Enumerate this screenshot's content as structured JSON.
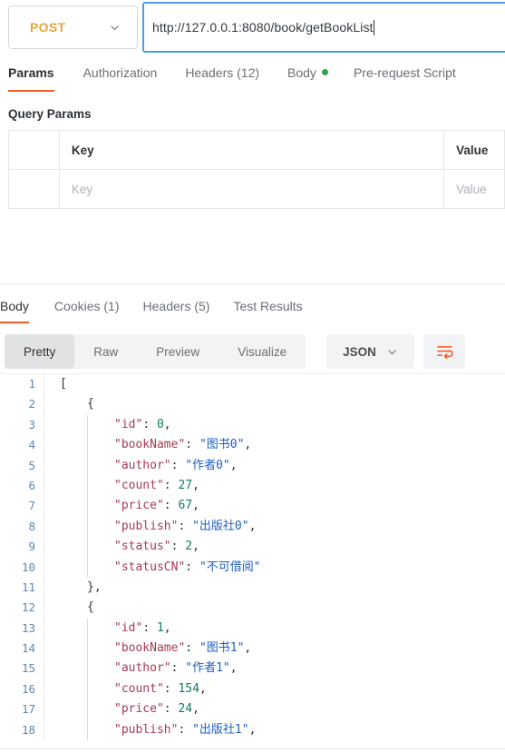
{
  "request": {
    "method": "POST",
    "method_caret_icon": "chevron-down-icon",
    "url": "http://127.0.0.1:8080/book/getBookList",
    "tabs": [
      {
        "label": "Params",
        "active": true
      },
      {
        "label": "Authorization",
        "active": false
      },
      {
        "label": "Headers (12)",
        "active": false
      },
      {
        "label": "Body",
        "active": false,
        "dot": true
      },
      {
        "label": "Pre-request Script",
        "active": false
      }
    ],
    "query_params": {
      "title": "Query Params",
      "columns": [
        "Key",
        "Value"
      ],
      "rows": [
        {
          "key_placeholder": "Key",
          "value_placeholder": "Value"
        }
      ]
    }
  },
  "response": {
    "tabs": [
      {
        "label": "Body",
        "active": true
      },
      {
        "label": "Cookies (1)",
        "active": false
      },
      {
        "label": "Headers (5)",
        "active": false
      },
      {
        "label": "Test Results",
        "active": false
      }
    ],
    "view_modes": [
      {
        "label": "Pretty",
        "active": true
      },
      {
        "label": "Raw",
        "active": false
      },
      {
        "label": "Preview",
        "active": false
      },
      {
        "label": "Visualize",
        "active": false
      }
    ],
    "format": {
      "label": "JSON",
      "caret_icon": "chevron-down-icon"
    },
    "wrap_icon": "wrap-lines-icon",
    "body_lines": [
      {
        "n": 1,
        "indent": 0,
        "tokens": [
          {
            "t": "p",
            "v": "["
          }
        ]
      },
      {
        "n": 2,
        "indent": 1,
        "tokens": [
          {
            "t": "p",
            "v": "{"
          }
        ]
      },
      {
        "n": 3,
        "indent": 2,
        "tokens": [
          {
            "t": "k",
            "v": "\"id\""
          },
          {
            "t": "p",
            "v": ": "
          },
          {
            "t": "n",
            "v": "0"
          },
          {
            "t": "p",
            "v": ","
          }
        ]
      },
      {
        "n": 4,
        "indent": 2,
        "tokens": [
          {
            "t": "k",
            "v": "\"bookName\""
          },
          {
            "t": "p",
            "v": ": "
          },
          {
            "t": "s",
            "v": "\"图书0\""
          },
          {
            "t": "p",
            "v": ","
          }
        ]
      },
      {
        "n": 5,
        "indent": 2,
        "tokens": [
          {
            "t": "k",
            "v": "\"author\""
          },
          {
            "t": "p",
            "v": ": "
          },
          {
            "t": "s",
            "v": "\"作者0\""
          },
          {
            "t": "p",
            "v": ","
          }
        ]
      },
      {
        "n": 6,
        "indent": 2,
        "tokens": [
          {
            "t": "k",
            "v": "\"count\""
          },
          {
            "t": "p",
            "v": ": "
          },
          {
            "t": "n",
            "v": "27"
          },
          {
            "t": "p",
            "v": ","
          }
        ]
      },
      {
        "n": 7,
        "indent": 2,
        "tokens": [
          {
            "t": "k",
            "v": "\"price\""
          },
          {
            "t": "p",
            "v": ": "
          },
          {
            "t": "n",
            "v": "67"
          },
          {
            "t": "p",
            "v": ","
          }
        ]
      },
      {
        "n": 8,
        "indent": 2,
        "tokens": [
          {
            "t": "k",
            "v": "\"publish\""
          },
          {
            "t": "p",
            "v": ": "
          },
          {
            "t": "s",
            "v": "\"出版社0\""
          },
          {
            "t": "p",
            "v": ","
          }
        ]
      },
      {
        "n": 9,
        "indent": 2,
        "tokens": [
          {
            "t": "k",
            "v": "\"status\""
          },
          {
            "t": "p",
            "v": ": "
          },
          {
            "t": "n",
            "v": "2"
          },
          {
            "t": "p",
            "v": ","
          }
        ]
      },
      {
        "n": 10,
        "indent": 2,
        "tokens": [
          {
            "t": "k",
            "v": "\"statusCN\""
          },
          {
            "t": "p",
            "v": ": "
          },
          {
            "t": "s",
            "v": "\"不可借阅\""
          }
        ]
      },
      {
        "n": 11,
        "indent": 1,
        "tokens": [
          {
            "t": "p",
            "v": "},"
          }
        ]
      },
      {
        "n": 12,
        "indent": 1,
        "tokens": [
          {
            "t": "p",
            "v": "{"
          }
        ]
      },
      {
        "n": 13,
        "indent": 2,
        "tokens": [
          {
            "t": "k",
            "v": "\"id\""
          },
          {
            "t": "p",
            "v": ": "
          },
          {
            "t": "n",
            "v": "1"
          },
          {
            "t": "p",
            "v": ","
          }
        ]
      },
      {
        "n": 14,
        "indent": 2,
        "tokens": [
          {
            "t": "k",
            "v": "\"bookName\""
          },
          {
            "t": "p",
            "v": ": "
          },
          {
            "t": "s",
            "v": "\"图书1\""
          },
          {
            "t": "p",
            "v": ","
          }
        ]
      },
      {
        "n": 15,
        "indent": 2,
        "tokens": [
          {
            "t": "k",
            "v": "\"author\""
          },
          {
            "t": "p",
            "v": ": "
          },
          {
            "t": "s",
            "v": "\"作者1\""
          },
          {
            "t": "p",
            "v": ","
          }
        ]
      },
      {
        "n": 16,
        "indent": 2,
        "tokens": [
          {
            "t": "k",
            "v": "\"count\""
          },
          {
            "t": "p",
            "v": ": "
          },
          {
            "t": "n",
            "v": "154"
          },
          {
            "t": "p",
            "v": ","
          }
        ]
      },
      {
        "n": 17,
        "indent": 2,
        "tokens": [
          {
            "t": "k",
            "v": "\"price\""
          },
          {
            "t": "p",
            "v": ": "
          },
          {
            "t": "n",
            "v": "24"
          },
          {
            "t": "p",
            "v": ","
          }
        ]
      },
      {
        "n": 18,
        "indent": 2,
        "tokens": [
          {
            "t": "k",
            "v": "\"publish\""
          },
          {
            "t": "p",
            "v": ": "
          },
          {
            "t": "s",
            "v": "\"出版社1\""
          },
          {
            "t": "p",
            "v": ","
          }
        ]
      }
    ]
  },
  "colors": {
    "accent": "#ef5b25",
    "focus_blue": "#4d9ce8",
    "method_orange": "#e8a33d",
    "dot_green": "#2ba84a",
    "json_key": "#a63b55",
    "json_string": "#1f5fbf",
    "json_number": "#0e7c66",
    "line_number": "#5e87ad"
  }
}
